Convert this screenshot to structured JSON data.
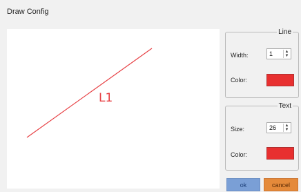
{
  "window": {
    "title": "Draw Config"
  },
  "canvas": {
    "line_label": "L1",
    "line_color": "#e74044"
  },
  "line_group": {
    "legend": "Line",
    "width_label": "Width:",
    "width_value": "1",
    "color_label": "Color:",
    "color": "#e83030"
  },
  "text_group": {
    "legend": "Text",
    "size_label": "Size:",
    "size_value": "26",
    "color_label": "Color:",
    "color": "#e83030"
  },
  "buttons": {
    "ok": "ok",
    "cancel": "cancel"
  },
  "icons": {
    "spin_up": "▲",
    "spin_down": "▼"
  }
}
